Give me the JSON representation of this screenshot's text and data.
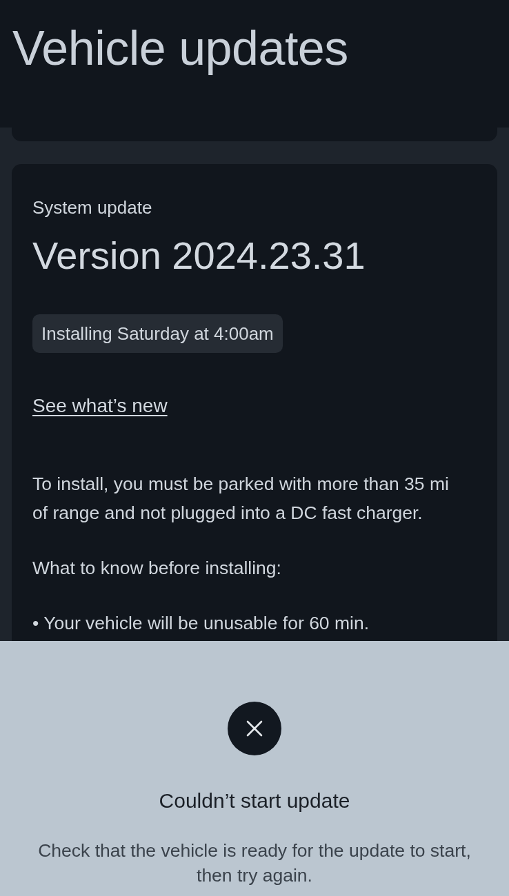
{
  "header": {
    "title": "Vehicle updates"
  },
  "update_card": {
    "label": "System update",
    "version": "Version 2024.23.31",
    "schedule_badge": "Installing Saturday at 4:00am",
    "link": "See what’s new",
    "requirements": "To install, you must be parked with more than 35 mi of range and not plugged into a DC fast charger.",
    "notes_heading": "What to know before installing:",
    "notes": [
      "• Your vehicle will be unusable for 60 min."
    ]
  },
  "error_sheet": {
    "title": "Couldn’t start update",
    "message": "Check that the vehicle is ready for the update to start, then try again."
  }
}
